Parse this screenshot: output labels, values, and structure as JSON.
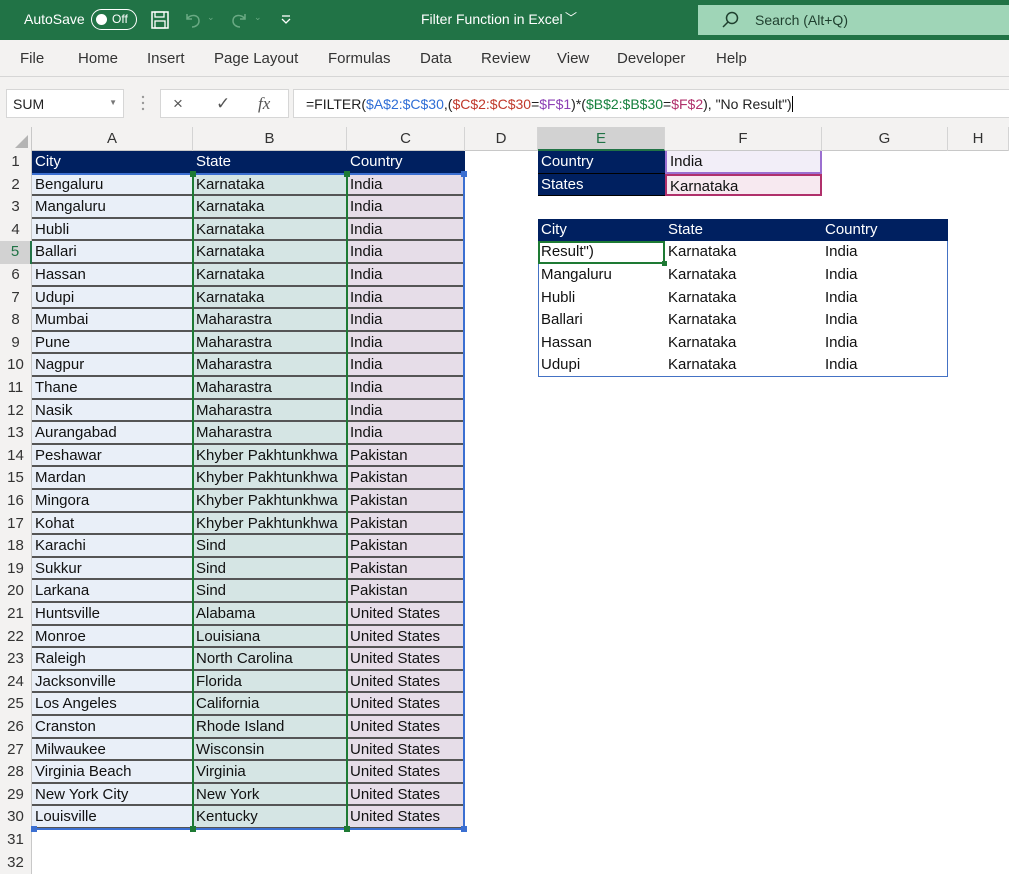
{
  "titlebar": {
    "autosave_label": "AutoSave",
    "autosave_state": "Off",
    "document_title": "Filter Function in Excel",
    "search_placeholder": "Search (Alt+Q)",
    "icons": [
      "save-icon",
      "undo-icon",
      "redo-icon",
      "customize-qat-icon"
    ]
  },
  "ribbon": {
    "tabs": [
      "File",
      "Home",
      "Insert",
      "Page Layout",
      "Formulas",
      "Data",
      "Review",
      "View",
      "Developer",
      "Help"
    ]
  },
  "formula_bar": {
    "name_box": "SUM",
    "cancel_icon": "×",
    "enter_icon": "✓",
    "fx_label": "fx",
    "formula_parts": [
      {
        "text": "=FILTER(",
        "color": "default"
      },
      {
        "text": "$A$2:$C$30",
        "color": "blue"
      },
      {
        "text": ",(",
        "color": "default"
      },
      {
        "text": "$C$2:$C$30",
        "color": "red"
      },
      {
        "text": "=",
        "color": "default"
      },
      {
        "text": "$F$1",
        "color": "purple"
      },
      {
        "text": ")*(",
        "color": "default"
      },
      {
        "text": "$B$2:$B$30",
        "color": "green"
      },
      {
        "text": "=",
        "color": "default"
      },
      {
        "text": "$F$2",
        "color": "magenta"
      },
      {
        "text": "), \"No Result\")",
        "color": "default"
      }
    ]
  },
  "grid": {
    "columns": [
      "A",
      "B",
      "C",
      "D",
      "E",
      "F",
      "G",
      "H"
    ],
    "selected_column": "E",
    "selected_row": 5,
    "row_numbers": [
      1,
      2,
      3,
      4,
      5,
      6,
      7,
      8,
      9,
      10,
      11,
      12,
      13,
      14,
      15,
      16,
      17,
      18,
      19,
      20,
      21,
      22,
      23,
      24,
      25,
      26,
      27,
      28,
      29,
      30,
      31,
      32
    ],
    "source_table": {
      "headers": [
        "City",
        "State",
        "Country"
      ],
      "rows": [
        [
          "Bengaluru",
          "Karnataka",
          "India"
        ],
        [
          "Mangaluru",
          "Karnataka",
          "India"
        ],
        [
          "Hubli",
          "Karnataka",
          "India"
        ],
        [
          "Ballari",
          "Karnataka",
          "India"
        ],
        [
          "Hassan",
          "Karnataka",
          "India"
        ],
        [
          "Udupi",
          "Karnataka",
          "India"
        ],
        [
          "Mumbai",
          "Maharastra",
          "India"
        ],
        [
          "Pune",
          "Maharastra",
          "India"
        ],
        [
          "Nagpur",
          "Maharastra",
          "India"
        ],
        [
          "Thane",
          "Maharastra",
          "India"
        ],
        [
          "Nasik",
          "Maharastra",
          "India"
        ],
        [
          "Aurangabad",
          "Maharastra",
          "India"
        ],
        [
          "Peshawar",
          "Khyber Pakhtunkhwa",
          "Pakistan"
        ],
        [
          "Mardan",
          "Khyber Pakhtunkhwa",
          "Pakistan"
        ],
        [
          "Mingora",
          "Khyber Pakhtunkhwa",
          "Pakistan"
        ],
        [
          "Kohat",
          "Khyber Pakhtunkhwa",
          "Pakistan"
        ],
        [
          "Karachi",
          "Sind",
          "Pakistan"
        ],
        [
          "Sukkur",
          "Sind",
          "Pakistan"
        ],
        [
          "Larkana",
          "Sind",
          "Pakistan"
        ],
        [
          "Huntsville",
          "Alabama",
          "United States"
        ],
        [
          "Monroe",
          "Louisiana",
          "United States"
        ],
        [
          "Raleigh",
          "North Carolina",
          "United States"
        ],
        [
          "Jacksonville",
          "Florida",
          "United States"
        ],
        [
          "Los Angeles",
          "California",
          "United States"
        ],
        [
          "Cranston",
          "Rhode Island",
          "United States"
        ],
        [
          "Milwaukee",
          "Wisconsin",
          "United States"
        ],
        [
          "Virginia Beach",
          "Virginia",
          "United States"
        ],
        [
          "New York City",
          "New York",
          "United States"
        ],
        [
          "Louisville",
          "Kentucky",
          "United States"
        ]
      ]
    },
    "criteria": [
      {
        "label": "Country",
        "value": "India"
      },
      {
        "label": "States",
        "value": "Karnataka"
      }
    ],
    "result_table": {
      "headers": [
        "City",
        "State",
        "Country"
      ],
      "rows": [
        [
          "Result\")",
          "Karnataka",
          "India"
        ],
        [
          "Mangaluru",
          "Karnataka",
          "India"
        ],
        [
          "Hubli",
          "Karnataka",
          "India"
        ],
        [
          "Ballari",
          "Karnataka",
          "India"
        ],
        [
          "Hassan",
          "Karnataka",
          "India"
        ],
        [
          "Udupi",
          "Karnataka",
          "India"
        ]
      ]
    }
  },
  "colors": {
    "excel_green": "#217346",
    "header_navy": "#002060",
    "col_a_fill": "#e9eff8",
    "col_b_fill": "#d5e5e4",
    "col_c_fill": "#e6dde8",
    "ref_blue": "#2f6ed6",
    "ref_red": "#c0392b",
    "ref_purple": "#8c3fb5",
    "ref_green": "#15803d",
    "ref_magenta": "#b0306b"
  }
}
